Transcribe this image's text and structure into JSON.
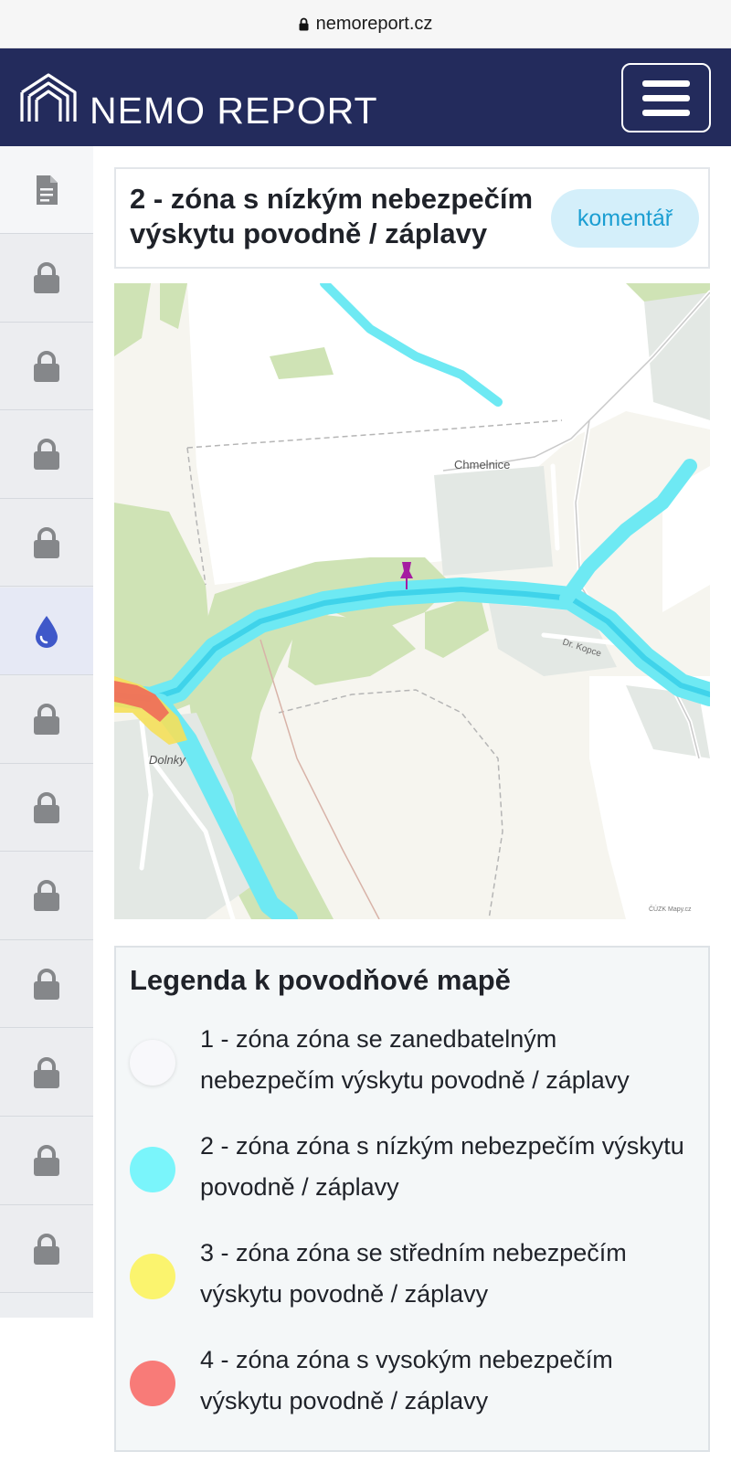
{
  "browser": {
    "url": "nemoreport.cz"
  },
  "header": {
    "brand": "NEMO REPORT",
    "menu_icon": "hamburger-menu-icon"
  },
  "sidebar": {
    "items": [
      {
        "icon": "document-icon",
        "state": "available"
      },
      {
        "icon": "lock-icon",
        "state": "locked"
      },
      {
        "icon": "lock-icon",
        "state": "locked"
      },
      {
        "icon": "lock-icon",
        "state": "locked"
      },
      {
        "icon": "lock-icon",
        "state": "locked"
      },
      {
        "icon": "water-drop-icon",
        "state": "active"
      },
      {
        "icon": "lock-icon",
        "state": "locked"
      },
      {
        "icon": "lock-icon",
        "state": "locked"
      },
      {
        "icon": "lock-icon",
        "state": "locked"
      },
      {
        "icon": "lock-icon",
        "state": "locked"
      },
      {
        "icon": "lock-icon",
        "state": "locked"
      },
      {
        "icon": "lock-icon",
        "state": "locked"
      },
      {
        "icon": "lock-icon",
        "state": "locked"
      }
    ]
  },
  "zone": {
    "title": "2 - zóna s nízkým nebezpečím výskytu povodně / záplavy",
    "comment_label": "komentář"
  },
  "map": {
    "place_labels": [
      "Chmelnice",
      "Dolnky",
      "Dr. Kopce"
    ],
    "attribution": "ČÚZK Mapy.cz"
  },
  "legend": {
    "title": "Legenda k povodňové mapě",
    "items": [
      {
        "text": "1 - zóna zóna se zanedbatelným nebezpečím výskytu povodně / záplavy",
        "color": "#f8f8fb"
      },
      {
        "text": "2 - zóna zóna s nízkým nebezpečím výskytu povodně / záplavy",
        "color": "#7af5fb"
      },
      {
        "text": "3 - zóna zóna se středním nebezpečím výskytu povodně / záplavy",
        "color": "#fbf46e"
      },
      {
        "text": "4 - zóna zóna s vysokým nebezpečím výskytu povodně / záplavy",
        "color": "#f87b78"
      }
    ]
  },
  "colors": {
    "header_bg": "#232b5c",
    "comment_bg": "#d4effa",
    "comment_text": "#1b9ed2",
    "drop_icon": "#3f58c9",
    "lock_icon": "#85878a"
  }
}
